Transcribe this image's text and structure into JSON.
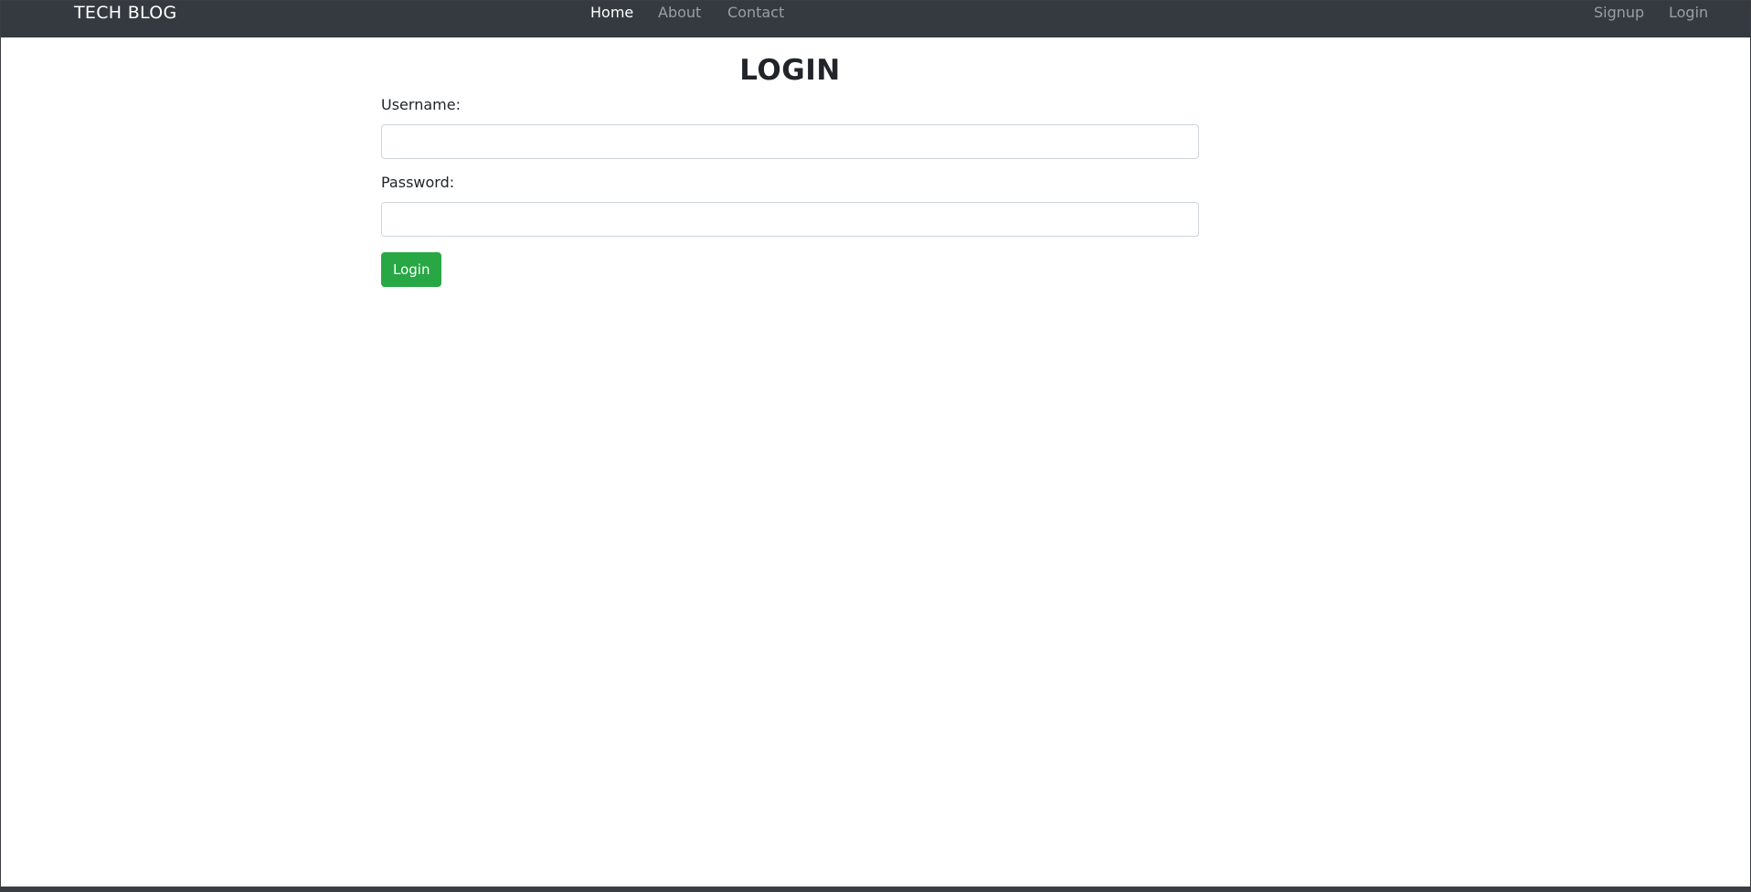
{
  "navbar": {
    "brand": "TECH BLOG",
    "links": [
      {
        "label": "Home",
        "active": true
      },
      {
        "label": "About",
        "active": false
      },
      {
        "label": "Contact",
        "active": false
      }
    ],
    "auth_links": [
      {
        "label": "Signup"
      },
      {
        "label": "Login"
      }
    ]
  },
  "main": {
    "title": "LOGIN",
    "username": {
      "label": "Username:",
      "value": "",
      "placeholder": ""
    },
    "password": {
      "label": "Password:",
      "value": "",
      "placeholder": ""
    },
    "submit_label": "Login"
  },
  "colors": {
    "navbar_bg": "#343a40",
    "button_bg": "#28a745",
    "nav_active": "#ffffff",
    "nav_inactive": "rgba(255,255,255,0.5)"
  }
}
